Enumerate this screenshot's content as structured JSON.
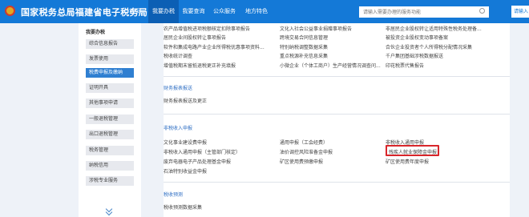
{
  "header": {
    "title": "国家税务总局福建省电子税务局",
    "nav": [
      "首页",
      "我要办税",
      "我要查询",
      "公众服务",
      "地方特色"
    ],
    "active_nav": "我要办税",
    "search_placeholder": "请输入需要办理的服务功能",
    "login": "请输入",
    "colors": {
      "bar": "#1479d7",
      "active": "#0c5fb4"
    }
  },
  "sidebar": {
    "title": "我要办税",
    "items": [
      "综合信息报告",
      "发票使用",
      "税费申报及缴纳",
      "证明开具",
      "其他事项申请",
      "一般退税管理",
      "出口退税管理",
      "税务管理",
      "纳税信用",
      "涉税专业服务"
    ],
    "active": "税费申报及缴纳"
  },
  "main": {
    "top_rows": [
      [
        "农产品增值税进项税额核定扣除事项报告",
        "文化入社会公益事业捐赠事项报告",
        "非居民企业股权转让适用特殊性税务处理备..."
      ],
      [
        "居民企业间股权转让事项报告",
        "跨境交易合同信息管理",
        "被投资企业股权变动事项备案"
      ],
      [
        "软件和集成电路产业企业所得税优惠事项资料...",
        "特别纳税调整数据采集",
        "合伙企业投资者个人所得税分配情况采集"
      ],
      [
        "税收统计调查",
        "重点税源补充信息采集",
        "千户集团基础涉税数据报送"
      ],
      [
        "增值税期末留抵退税更正补充填报",
        "小微企业（个体工商户）生产经营情况调查问...",
        "印花税票代售报告"
      ]
    ],
    "sections": {
      "correction": {
        "title": "财务报表报送",
        "items": [
          "财务报表报送及更正"
        ]
      },
      "nontax": {
        "title": "非税收入申报",
        "rows": [
          [
            "文化事业建设费申报",
            "通用申报（工会经费）",
            "非税收入通用申报"
          ],
          [
            "非税收入通用申报（主管部门核定）",
            "油价调控风险准备金申报",
            "残疾人就业保障金申报"
          ],
          [
            "废弃电器电子产品处理基金申报",
            "矿区使用费预缴申报",
            "矿区使用费年度申报"
          ],
          [
            "石油特别收益金申报"
          ]
        ],
        "highlighted": "残疾人就业保障金申报"
      },
      "forecast": {
        "title": "税收预测",
        "items": [
          "税收预测数据采集"
        ]
      }
    },
    "colors": {
      "highlight": "#d8262b",
      "section": "#2f6fc4"
    }
  }
}
